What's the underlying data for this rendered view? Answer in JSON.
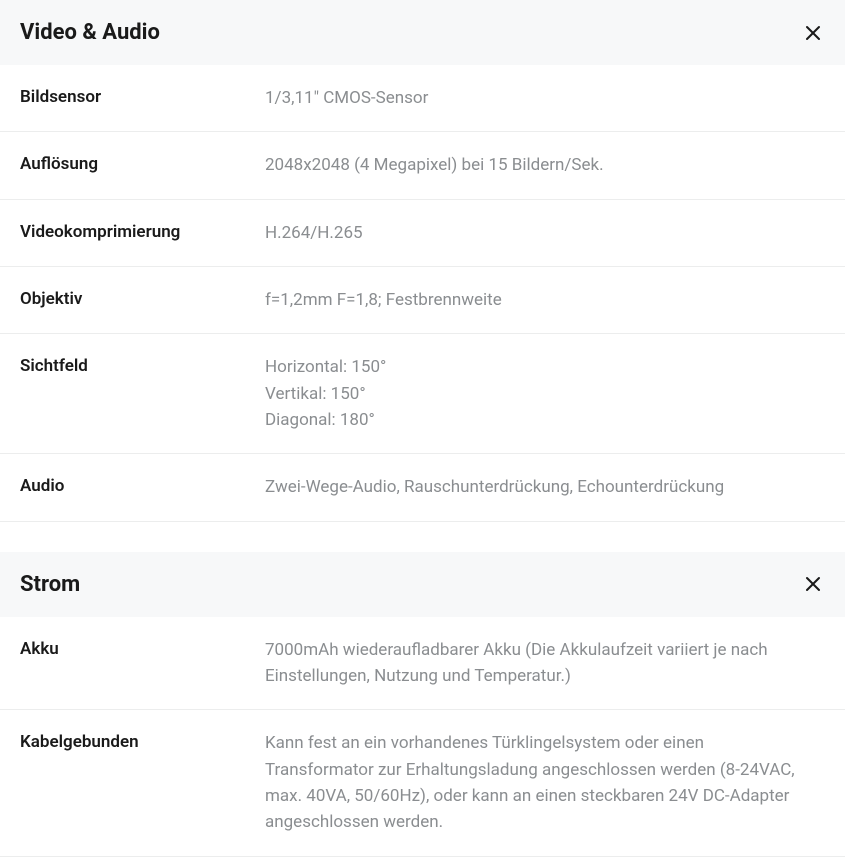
{
  "sections": [
    {
      "title": "Video & Audio",
      "rows": [
        {
          "label": "Bildsensor",
          "value": "1/3,11\" CMOS-Sensor"
        },
        {
          "label": "Auflösung",
          "value": "2048x2048 (4 Megapixel) bei 15 Bildern/Sek."
        },
        {
          "label": "Videokomprimierung",
          "value": "H.264/H.265"
        },
        {
          "label": "Objektiv",
          "value": "f=1,2mm F=1,8; Festbrennweite"
        },
        {
          "label": "Sichtfeld",
          "value": "Horizontal: 150°\nVertikal: 150°\nDiagonal: 180°"
        },
        {
          "label": "Audio",
          "value": "Zwei-Wege-Audio, Rauschunterdrückung, Echounterdrückung"
        }
      ]
    },
    {
      "title": "Strom",
      "rows": [
        {
          "label": "Akku",
          "value": "7000mAh wiederaufladbarer Akku (Die Akkulaufzeit variiert je nach Einstellungen, Nutzung und Temperatur.)"
        },
        {
          "label": "Kabelgebunden",
          "value": "Kann fest an ein vorhandenes Türklingelsystem oder einen Transformator zur Erhaltungsladung angeschlossen werden (8-24VAC, max. 40VA, 50/60Hz), oder kann an einen steckbaren 24V DC-Adapter angeschlossen werden."
        }
      ]
    }
  ]
}
